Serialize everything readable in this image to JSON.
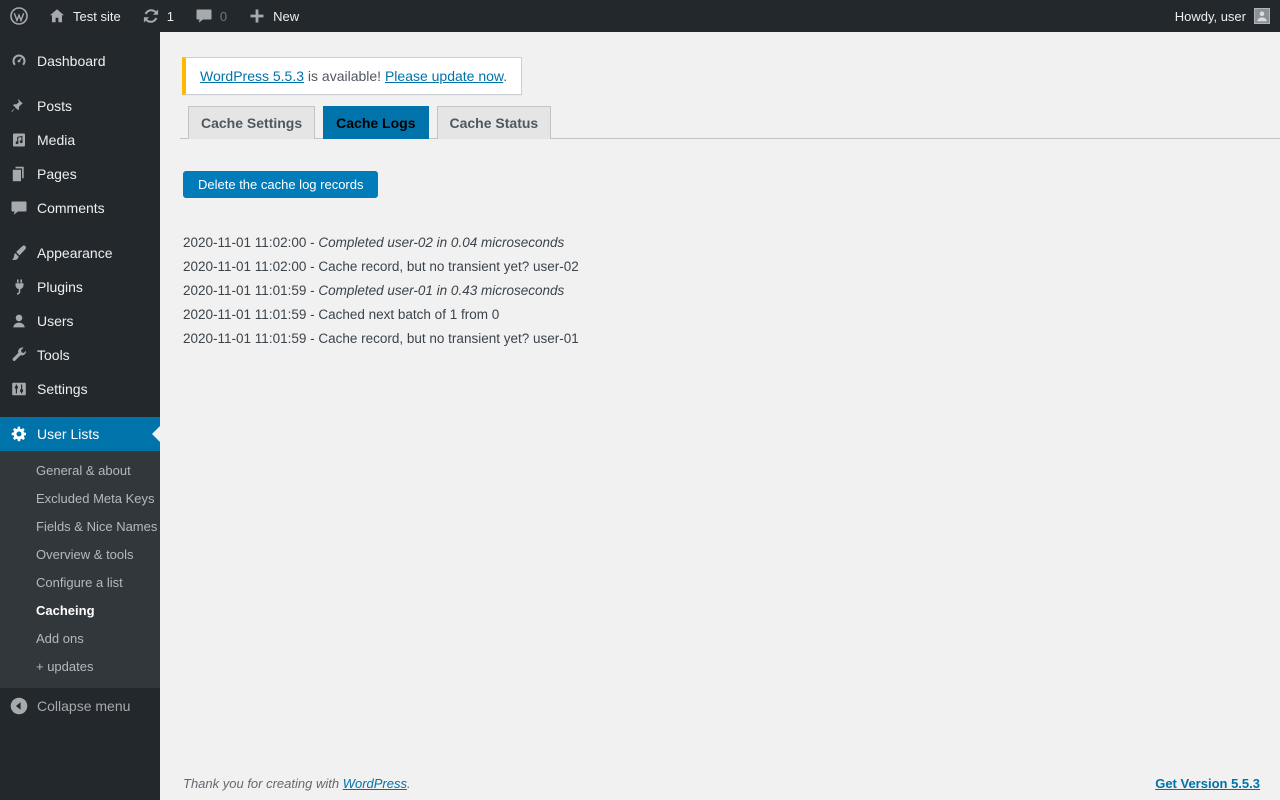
{
  "admin_bar": {
    "site_name": "Test site",
    "update_count": "1",
    "comment_count": "0",
    "new_label": "New",
    "howdy": "Howdy, user"
  },
  "sidebar": {
    "items": [
      {
        "label": "Dashboard"
      },
      {
        "label": "Posts"
      },
      {
        "label": "Media"
      },
      {
        "label": "Pages"
      },
      {
        "label": "Comments"
      },
      {
        "label": "Appearance"
      },
      {
        "label": "Plugins"
      },
      {
        "label": "Users"
      },
      {
        "label": "Tools"
      },
      {
        "label": "Settings"
      },
      {
        "label": "User Lists"
      }
    ],
    "submenu": [
      "General & about",
      "Excluded Meta Keys",
      "Fields & Nice Names",
      "Overview & tools",
      "Configure a list",
      "Cacheing",
      "Add ons",
      "+ updates"
    ],
    "collapse_label": "Collapse menu"
  },
  "notice": {
    "link_version": "WordPress 5.5.3",
    "middle": " is available! ",
    "link_update": "Please update now",
    "end": "."
  },
  "tabs": [
    {
      "label": "Cache Settings"
    },
    {
      "label": "Cache Logs"
    },
    {
      "label": "Cache Status"
    }
  ],
  "button_label": "Delete the cache log records",
  "logs": [
    {
      "prefix": "2020-11-01 11:02:00 - ",
      "message": "Completed user-02 in 0.04 microseconds"
    },
    {
      "prefix": "2020-11-01 11:02:00 - ",
      "message": "Cache record, but no transient yet? user-02"
    },
    {
      "prefix": "2020-11-01 11:01:59 - ",
      "message": "Completed user-01 in 0.43 microseconds"
    },
    {
      "prefix": "2020-11-01 11:01:59 - ",
      "message": "Cached next batch of 1 from 0"
    },
    {
      "prefix": "2020-11-01 11:01:59 - ",
      "message": "Cache record, but no transient yet? user-01"
    }
  ],
  "footer": {
    "left_prefix": "Thank you for creating with ",
    "left_link": "WordPress",
    "left_suffix": ".",
    "right_link": "Get Version 5.5.3"
  },
  "colors": {
    "admin_dark": "#23282d",
    "submenu_dark": "#32373c",
    "accent_blue": "#0073aa",
    "button_blue": "#007cba",
    "notice_yellow": "#ffb900",
    "content_bg": "#f1f1f1"
  }
}
